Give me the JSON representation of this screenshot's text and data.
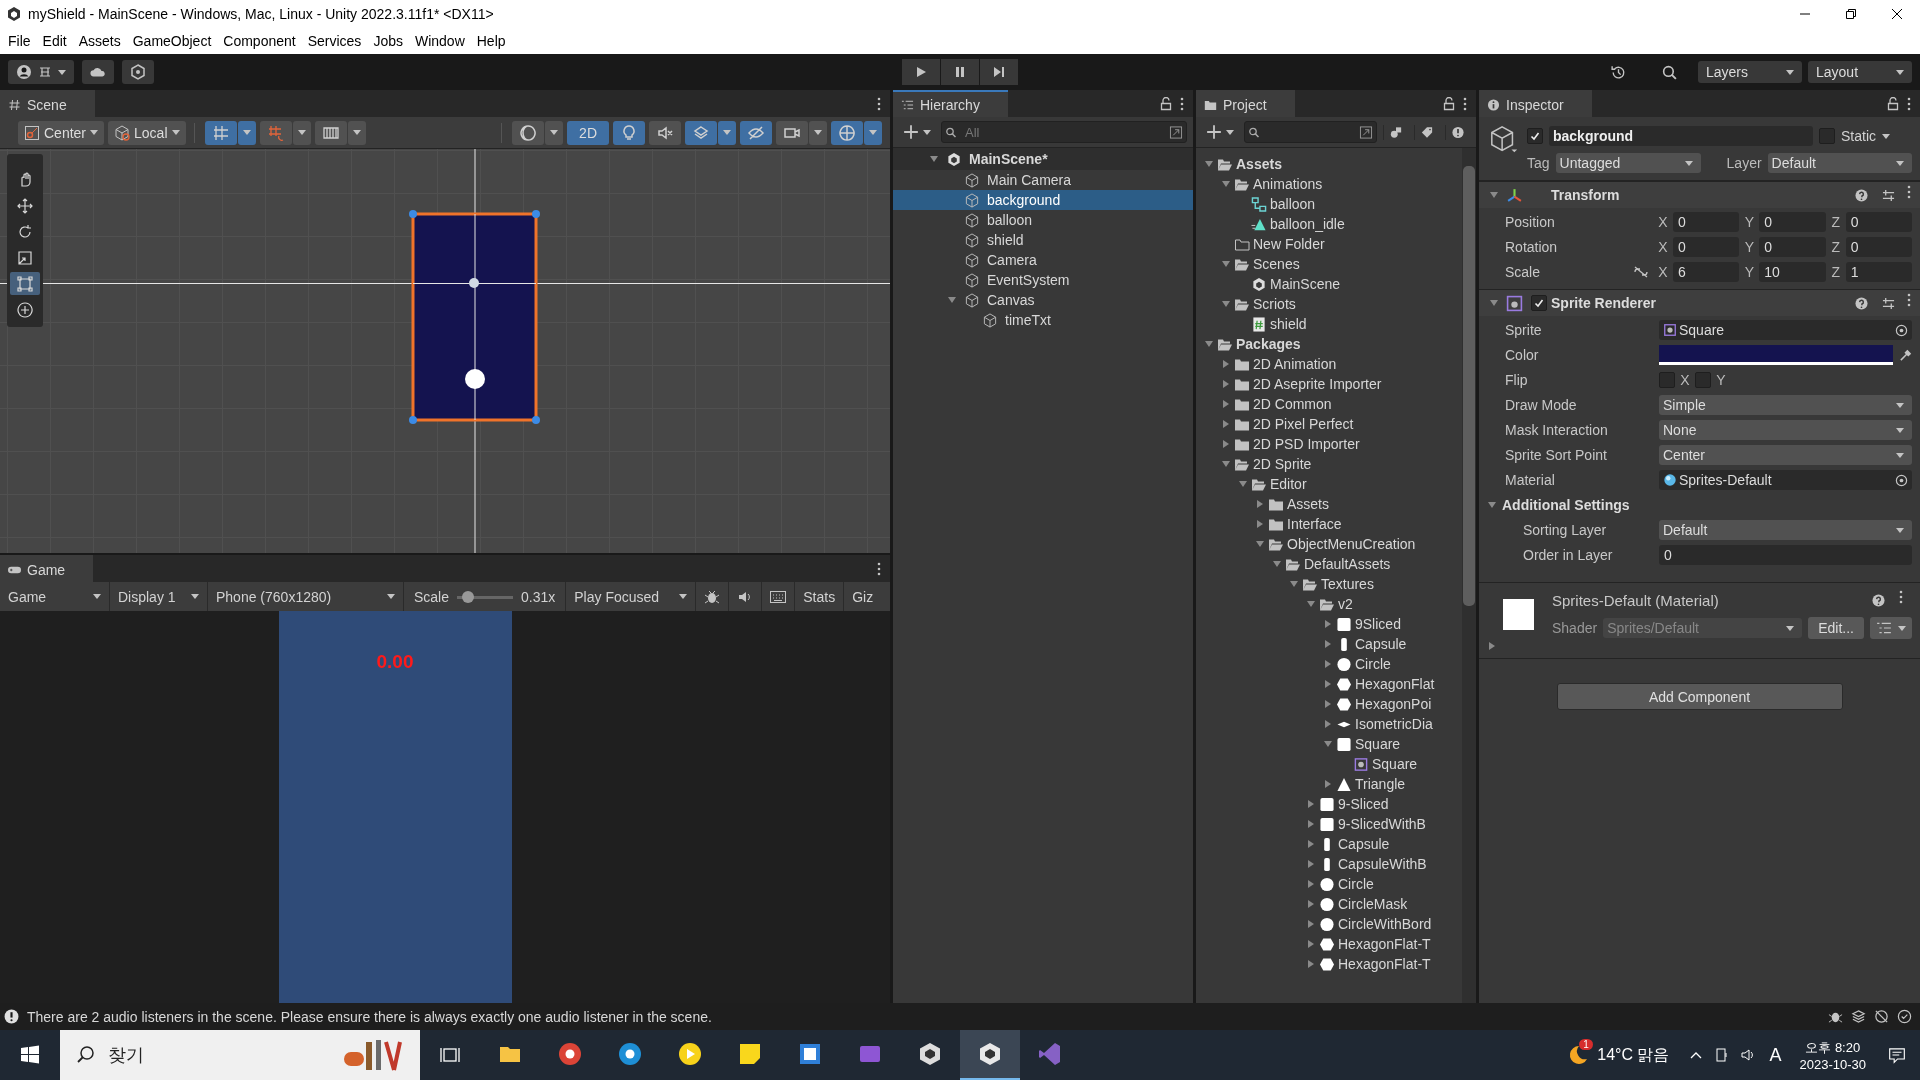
{
  "window": {
    "title": "myShield - MainScene - Windows, Mac, Linux - Unity 2022.3.11f1* <DX11>"
  },
  "menu": [
    "File",
    "Edit",
    "Assets",
    "GameObject",
    "Component",
    "Services",
    "Jobs",
    "Window",
    "Help"
  ],
  "toolbar": {
    "layers": "Layers",
    "layout": "Layout"
  },
  "scene": {
    "tab": "Scene",
    "pivot": "Center",
    "space": "Local",
    "mode_2d": {
      "label": "2D",
      "on": true
    },
    "snap_toggles": [
      {
        "kind": "grid_snap",
        "on": true
      },
      {
        "kind": "increment_snap",
        "on": false
      },
      {
        "kind": "grid",
        "on": false
      }
    ],
    "view_toggles": [
      {
        "kind": "shading",
        "on": false
      },
      {
        "kind": "lighting",
        "on": true
      },
      {
        "kind": "audio",
        "on": false
      },
      {
        "kind": "effects",
        "on": true
      },
      {
        "kind": "visibility",
        "on": true
      },
      {
        "kind": "camera",
        "on": false
      },
      {
        "kind": "gizmos",
        "on": true
      }
    ],
    "tools": [
      {
        "kind": "hand",
        "selected": false
      },
      {
        "kind": "move",
        "selected": false
      },
      {
        "kind": "rotate",
        "selected": false
      },
      {
        "kind": "scale",
        "selected": false
      },
      {
        "kind": "rect",
        "selected": true
      },
      {
        "kind": "transform",
        "selected": false
      }
    ]
  },
  "game": {
    "tab": "Game",
    "view": "Game",
    "display": "Display 1",
    "resolution": "Phone (760x1280)",
    "scale_label": "Scale",
    "scale_slider": {
      "level": 0.08
    },
    "scale": "0.31x",
    "play_mode": "Play Focused",
    "stats": "Stats",
    "gizmos": "Giz",
    "timer": "0.00"
  },
  "hierarchy": {
    "tab": "Hierarchy",
    "search_placeholder": "All",
    "items": [
      {
        "name": "MainScene*",
        "kind": "scene",
        "expanded": true,
        "selected": false,
        "children": [
          {
            "name": "Main Camera",
            "kind": "object",
            "selected": false
          },
          {
            "name": "background",
            "kind": "object",
            "selected": true
          },
          {
            "name": "balloon",
            "kind": "object",
            "selected": false
          },
          {
            "name": "shield",
            "kind": "object",
            "selected": false
          },
          {
            "name": "Camera",
            "kind": "object",
            "selected": false
          },
          {
            "name": "EventSystem",
            "kind": "object",
            "selected": false
          },
          {
            "name": "Canvas",
            "kind": "object",
            "expanded": true,
            "selected": false,
            "children": [
              {
                "name": "timeTxt",
                "kind": "object",
                "selected": false
              }
            ]
          }
        ]
      }
    ]
  },
  "project": {
    "tab": "Project",
    "items": [
      {
        "name": "Assets",
        "kind": "folder",
        "expanded": true,
        "children": [
          {
            "name": "Animations",
            "kind": "folder",
            "expanded": true,
            "children": [
              {
                "name": "balloon",
                "kind": "controller"
              },
              {
                "name": "balloon_idle",
                "kind": "clip"
              }
            ]
          },
          {
            "name": "New Folder",
            "kind": "empty_folder"
          },
          {
            "name": "Scenes",
            "kind": "folder",
            "expanded": true,
            "children": [
              {
                "name": "MainScene",
                "kind": "scene"
              }
            ]
          },
          {
            "name": "Scriots",
            "kind": "folder",
            "expanded": true,
            "children": [
              {
                "name": "shield",
                "kind": "script"
              }
            ]
          }
        ]
      },
      {
        "name": "Packages",
        "kind": "folder",
        "expanded": true,
        "children": [
          {
            "name": "2D Animation",
            "kind": "folder",
            "expanded": false
          },
          {
            "name": "2D Aseprite Importer",
            "kind": "folder",
            "expanded": false
          },
          {
            "name": "2D Common",
            "kind": "folder",
            "expanded": false
          },
          {
            "name": "2D Pixel Perfect",
            "kind": "folder",
            "expanded": false
          },
          {
            "name": "2D PSD Importer",
            "kind": "folder",
            "expanded": false
          },
          {
            "name": "2D Sprite",
            "kind": "folder",
            "expanded": true,
            "children": [
              {
                "name": "Editor",
                "kind": "folder",
                "expanded": true,
                "children": [
                  {
                    "name": "Assets",
                    "kind": "folder",
                    "expanded": false
                  },
                  {
                    "name": "Interface",
                    "kind": "folder",
                    "expanded": false
                  },
                  {
                    "name": "ObjectMenuCreation",
                    "kind": "folder",
                    "expanded": true,
                    "children": [
                      {
                        "name": "DefaultAssets",
                        "kind": "folder",
                        "expanded": true,
                        "children": [
                          {
                            "name": "Textures",
                            "kind": "folder",
                            "expanded": true,
                            "children": [
                              {
                                "name": "v2",
                                "kind": "folder",
                                "expanded": true,
                                "children": [
                                  {
                                    "name": "9Sliced",
                                    "kind": "square",
                                    "expanded": false
                                  },
                                  {
                                    "name": "Capsule",
                                    "kind": "capsule",
                                    "expanded": false
                                  },
                                  {
                                    "name": "Circle",
                                    "kind": "circle",
                                    "expanded": false
                                  },
                                  {
                                    "name": "HexagonFlat",
                                    "kind": "hexagon",
                                    "expanded": false
                                  },
                                  {
                                    "name": "HexagonPoi",
                                    "kind": "hexagon",
                                    "expanded": false
                                  },
                                  {
                                    "name": "IsometricDia",
                                    "kind": "diamond",
                                    "expanded": false
                                  },
                                  {
                                    "name": "Square",
                                    "kind": "square",
                                    "expanded": true,
                                    "children": [
                                      {
                                        "name": "Square",
                                        "kind": "sprite"
                                      }
                                    ]
                                  },
                                  {
                                    "name": "Triangle",
                                    "kind": "triangle",
                                    "expanded": false
                                  }
                                ]
                              },
                              {
                                "name": "9-Sliced",
                                "kind": "square",
                                "expanded": false
                              },
                              {
                                "name": "9-SlicedWithB",
                                "kind": "square",
                                "expanded": false
                              },
                              {
                                "name": "Capsule",
                                "kind": "capsule",
                                "expanded": false
                              },
                              {
                                "name": "CapsuleWithB",
                                "kind": "capsule",
                                "expanded": false
                              },
                              {
                                "name": "Circle",
                                "kind": "circle",
                                "expanded": false
                              },
                              {
                                "name": "CircleMask",
                                "kind": "circle",
                                "expanded": false
                              },
                              {
                                "name": "CircleWithBord",
                                "kind": "circle",
                                "expanded": false
                              },
                              {
                                "name": "HexagonFlat-T",
                                "kind": "hexagon",
                                "expanded": false
                              },
                              {
                                "name": "HexagonFlat-T",
                                "kind": "hexagon",
                                "expanded": false
                              }
                            ]
                          }
                        ]
                      }
                    ]
                  }
                ]
              }
            ]
          }
        ]
      }
    ]
  },
  "inspector": {
    "tab": "Inspector",
    "object": {
      "active": true,
      "name": "background",
      "static": false,
      "static_label": "Static",
      "tag_label": "Tag",
      "tag": "Untagged",
      "layer_label": "Layer",
      "layer": "Default"
    },
    "components": [
      {
        "kind": "transform",
        "title": "Transform",
        "expanded": true,
        "rows": [
          {
            "label": "Position",
            "values": [
              {
                "axis": "X",
                "value": "0"
              },
              {
                "axis": "Y",
                "value": "0"
              },
              {
                "axis": "Z",
                "value": "0"
              }
            ]
          },
          {
            "label": "Rotation",
            "values": [
              {
                "axis": "X",
                "value": "0"
              },
              {
                "axis": "Y",
                "value": "0"
              },
              {
                "axis": "Z",
                "value": "0"
              }
            ]
          },
          {
            "label": "Scale",
            "values": [
              {
                "axis": "X",
                "value": "6"
              },
              {
                "axis": "Y",
                "value": "10"
              },
              {
                "axis": "Z",
                "value": "1"
              }
            ]
          }
        ]
      },
      {
        "kind": "sprite_renderer",
        "title": "Sprite Renderer",
        "expanded": true,
        "enabled": true,
        "properties": [
          {
            "kind": "sprite_ref",
            "label": "Sprite",
            "value": "Square"
          },
          {
            "kind": "color",
            "label": "Color",
            "color": "#14134f"
          },
          {
            "kind": "flip",
            "label": "Flip",
            "options": [
              {
                "label": "X",
                "checked": false
              },
              {
                "label": "Y",
                "checked": false
              }
            ]
          },
          {
            "kind": "dropdown",
            "label": "Draw Mode",
            "value": "Simple"
          },
          {
            "kind": "dropdown",
            "label": "Mask Interaction",
            "value": "None"
          },
          {
            "kind": "dropdown",
            "label": "Sprite Sort Point",
            "value": "Center"
          },
          {
            "kind": "material_ref",
            "label": "Material",
            "value": "Sprites-Default"
          }
        ],
        "group": {
          "title": "Additional Settings",
          "expanded": true,
          "properties": [
            {
              "kind": "dropdown",
              "label": "Sorting Layer",
              "value": "Default"
            },
            {
              "kind": "number",
              "label": "Order in Layer",
              "value": "0"
            }
          ]
        }
      }
    ],
    "material": {
      "title": "Sprites-Default (Material)",
      "shader_label": "Shader",
      "shader": "Sprites/Default",
      "edit": "Edit...",
      "expanded": false
    },
    "add_component": "Add Component"
  },
  "console": {
    "message": "There are 2 audio listeners in the scene. Please ensure there is always exactly one audio listener in the scene."
  },
  "taskbar": {
    "search_placeholder": "찾기",
    "apps": [
      {
        "kind": "files",
        "active": false
      },
      {
        "kind": "chrome",
        "active": false
      },
      {
        "kind": "edge",
        "active": false
      },
      {
        "kind": "player",
        "active": false
      },
      {
        "kind": "notes",
        "active": false
      },
      {
        "kind": "video",
        "active": false
      },
      {
        "kind": "clips",
        "active": false
      },
      {
        "kind": "hub",
        "active": false
      },
      {
        "kind": "unity",
        "active": true
      },
      {
        "kind": "vs",
        "active": false
      }
    ],
    "weather_badge": "1",
    "weather": "14°C 맑음",
    "ime": "A",
    "time": "오후 8:20",
    "date": "2023-10-30"
  }
}
